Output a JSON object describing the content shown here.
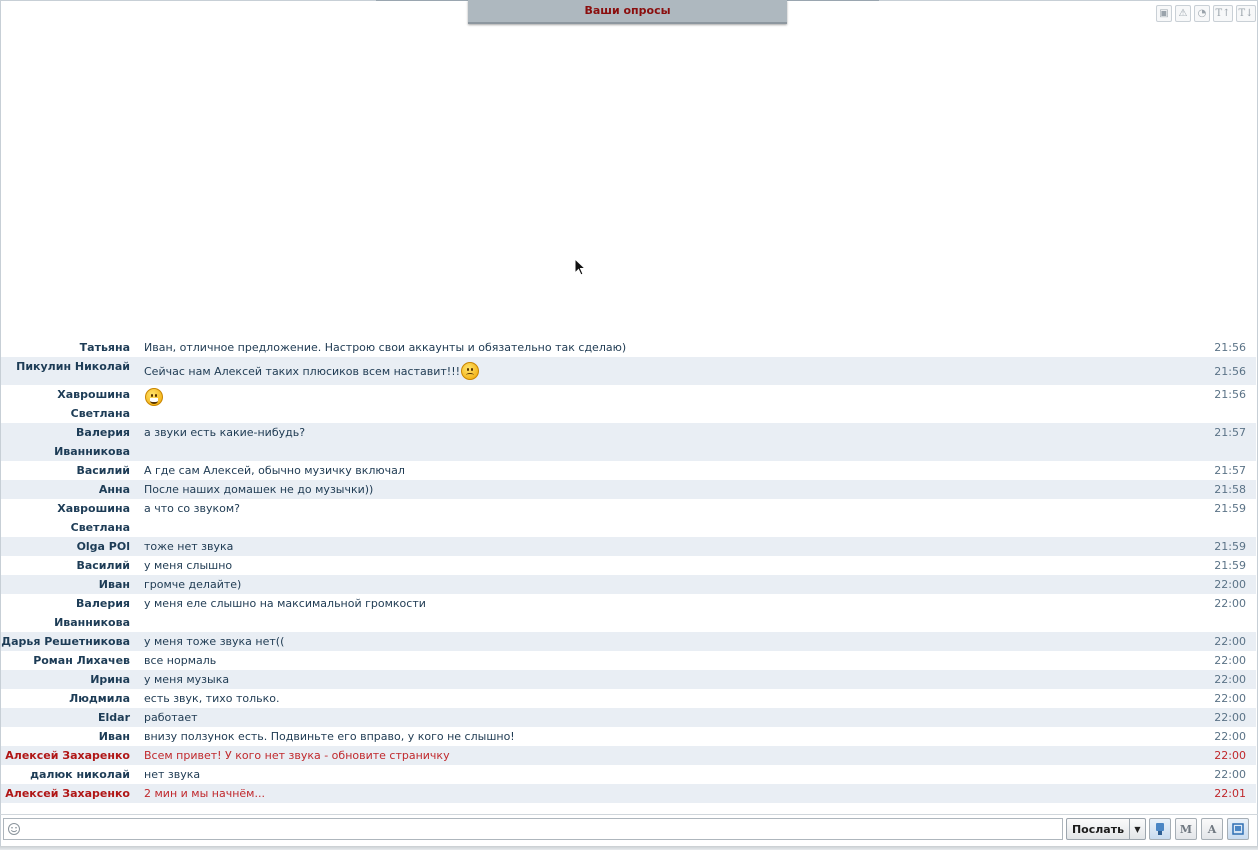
{
  "header": {
    "polls_tab_label": "Ваши опросы"
  },
  "top_tools": {
    "items": [
      {
        "icon": "image-icon",
        "glyph": "▣"
      },
      {
        "icon": "warning-icon",
        "glyph": "⚠"
      },
      {
        "icon": "chart-pie-icon",
        "glyph": "◔"
      },
      {
        "icon": "font-increase-icon",
        "glyph": "T↑"
      },
      {
        "icon": "font-decrease-icon",
        "glyph": "T↓"
      }
    ]
  },
  "messages": [
    {
      "author": "Татьяна",
      "text": "Иван, отличное предложение. Настрою свои аккаунты и обязательно так сделаю)",
      "time": "21:56"
    },
    {
      "author": "Пикулин Николай",
      "text": "Сейчас нам Алексей таких плюсиков всем наставит!!!",
      "emoji": "sad-face-icon",
      "time": "21:56"
    },
    {
      "author": "Хаврошина Светлана",
      "text": "",
      "emoji": "grin-face-icon",
      "time": "21:56"
    },
    {
      "author": "Валерия Иванникова",
      "text": "а звуки есть какие-нибудь?",
      "time": "21:57"
    },
    {
      "author": "Василий",
      "text": "А где сам Алексей, обычно музичку включал",
      "time": "21:57"
    },
    {
      "author": "Анна",
      "text": "После наших домашек не до музычки))",
      "time": "21:58"
    },
    {
      "author": "Хаврошина Светлана",
      "text": "а что со звуком?",
      "time": "21:59"
    },
    {
      "author": "Olga POl",
      "text": "тоже нет звука",
      "time": "21:59"
    },
    {
      "author": "Василий",
      "text": "у меня слышно",
      "time": "21:59"
    },
    {
      "author": "Иван",
      "text": "громче делайте)",
      "time": "22:00"
    },
    {
      "author": "Валерия Иванникова",
      "text": "у меня еле слышно на максимальной громкости",
      "time": "22:00"
    },
    {
      "author": "Дарья Решетникова",
      "text": "у меня тоже звука нет((",
      "time": "22:00"
    },
    {
      "author": "Роман Лихачев",
      "text": "все нормаль",
      "time": "22:00"
    },
    {
      "author": "Ирина",
      "text": "у меня музыка",
      "time": "22:00"
    },
    {
      "author": "Людмила",
      "text": "есть звук, тихо только.",
      "time": "22:00"
    },
    {
      "author": "Eldar",
      "text": "работает",
      "time": "22:00"
    },
    {
      "author": "Иван",
      "text": "внизу ползунок есть. Подвиньте его вправо, у кого не слышно!",
      "time": "22:00"
    },
    {
      "author": "Алексей Захаренко",
      "text": "Всем привет! У кого нет звука - обновите страничку",
      "time": "22:00",
      "admin": true
    },
    {
      "author": "далюк николай",
      "text": "нет звука",
      "time": "22:00"
    },
    {
      "author": "Алексей Захаренко",
      "text": "2 мин и мы начнём...",
      "time": "22:01",
      "admin": true
    }
  ],
  "input": {
    "value": "",
    "placeholder": ""
  },
  "send": {
    "label": "Послать"
  },
  "bottom_tools": {
    "items": [
      {
        "icon": "brush-icon",
        "glyph": "🖌"
      },
      {
        "icon": "format-m-icon",
        "glyph": "M"
      },
      {
        "icon": "font-size-icon",
        "glyph": "A"
      },
      {
        "icon": "window-icon",
        "glyph": "▤"
      }
    ]
  }
}
